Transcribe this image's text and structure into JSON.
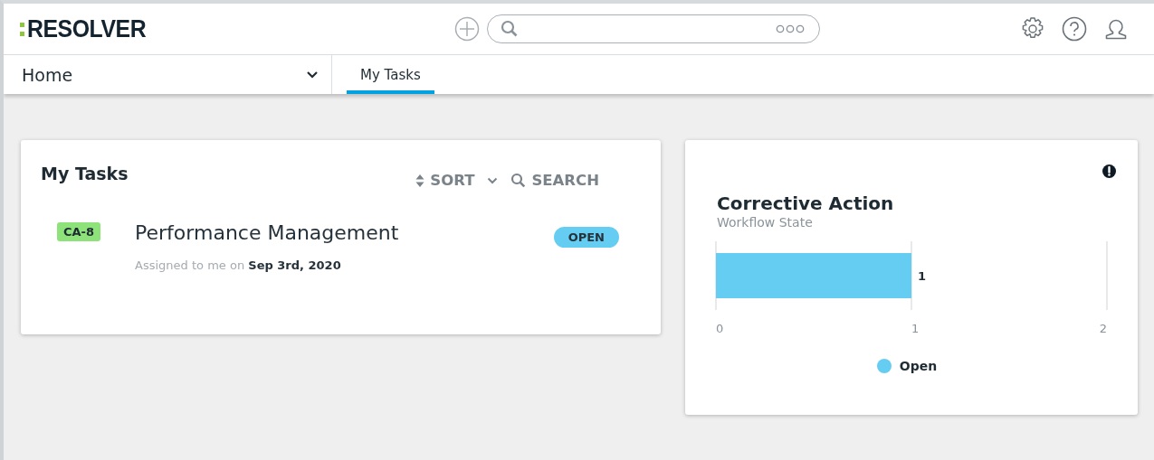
{
  "header": {
    "logo": "RESOLVER"
  },
  "nav": {
    "menu": "Home",
    "tabs": [
      {
        "label": "My Tasks",
        "selected": true
      }
    ]
  },
  "tasks_card": {
    "title": "My Tasks",
    "sort": "SORT",
    "search": "SEARCH",
    "tasks": [
      {
        "id": "CA-8",
        "title": "Performance Management",
        "assigned_prefix": "Assigned to me on",
        "date": "Sep 3rd, 2020",
        "status": "OPEN"
      }
    ]
  },
  "chart_card": {
    "title": "Corrective Action",
    "subtitle": "Workflow State",
    "chart_data": {
      "type": "bar",
      "orientation": "horizontal",
      "series": [
        {
          "name": "Open",
          "color": "#66cdf2",
          "values": [
            1
          ]
        }
      ],
      "xlim": [
        0,
        2
      ],
      "xticks": [
        0,
        1,
        2
      ],
      "data_labels": true
    }
  }
}
